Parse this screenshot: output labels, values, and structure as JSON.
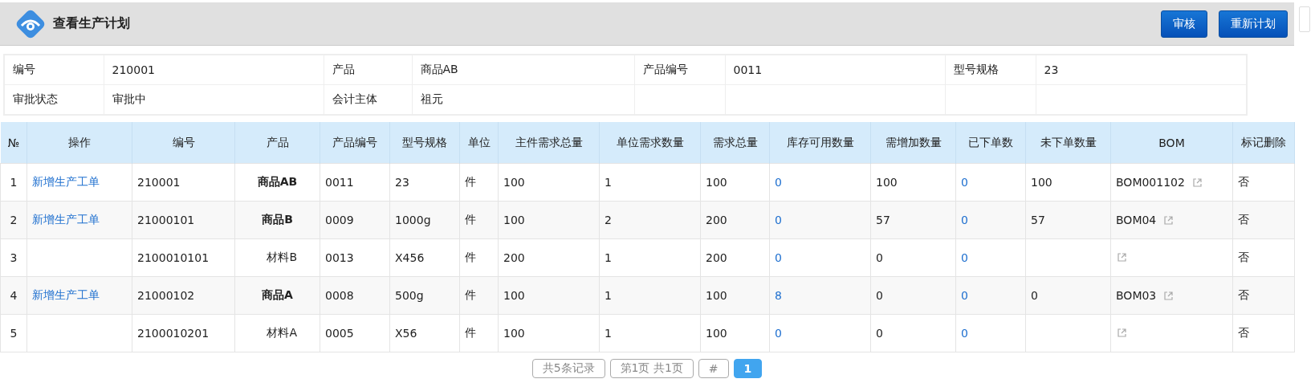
{
  "header": {
    "title": "查看生产计划",
    "buttons": [
      "审核",
      "重新计划"
    ]
  },
  "info": [
    [
      {
        "label": "编号",
        "value": "210001"
      },
      {
        "label": "产品",
        "value": "商品AB"
      },
      {
        "label": "产品编号",
        "value": "0011"
      },
      {
        "label": "型号规格",
        "value": "23"
      }
    ],
    [
      {
        "label": "审批状态",
        "value": "审批中"
      },
      {
        "label": "会计主体",
        "value": "祖元"
      }
    ]
  ],
  "table": {
    "columns": [
      "№",
      "操作",
      "编号",
      "产品",
      "产品编号",
      "型号规格",
      "单位",
      "主件需求总量",
      "单位需求数量",
      "需求总量",
      "库存可用数量",
      "需增加数量",
      "已下单数",
      "未下单数量",
      "BOM",
      "标记删除"
    ],
    "rows": [
      {
        "no": "1",
        "action": "新增生产工单",
        "code": "210001",
        "product": "商品AB",
        "kind": "product",
        "product_code": "0011",
        "spec": "23",
        "unit": "件",
        "main_qty": "100",
        "unit_qty": "1",
        "total_qty": "100",
        "stock": "0",
        "increase": "100",
        "ordered": "0",
        "unordered": "100",
        "bom": "BOM001102",
        "deleted": "否"
      },
      {
        "no": "2",
        "action": "新增生产工单",
        "code": "21000101",
        "product": "商品B",
        "kind": "product",
        "product_code": "0009",
        "spec": "1000g",
        "unit": "件",
        "main_qty": "100",
        "unit_qty": "2",
        "total_qty": "200",
        "stock": "0",
        "increase": "57",
        "ordered": "0",
        "unordered": "57",
        "bom": "BOM04",
        "deleted": "否"
      },
      {
        "no": "3",
        "code": "2100010101",
        "product": "材料B",
        "kind": "material",
        "product_code": "0013",
        "spec": "X456",
        "unit": "件",
        "main_qty": "200",
        "unit_qty": "1",
        "total_qty": "200",
        "stock": "0",
        "increase": "0",
        "ordered": "0",
        "deleted": "否"
      },
      {
        "no": "4",
        "action": "新增生产工单",
        "code": "21000102",
        "product": "商品A",
        "kind": "product",
        "product_code": "0008",
        "spec": "500g",
        "unit": "件",
        "main_qty": "100",
        "unit_qty": "1",
        "total_qty": "100",
        "stock": "8",
        "increase": "0",
        "ordered": "0",
        "unordered": "0",
        "bom": "BOM03",
        "deleted": "否"
      },
      {
        "no": "5",
        "code": "2100010201",
        "product": "材料A",
        "kind": "material",
        "product_code": "0005",
        "spec": "X56",
        "unit": "件",
        "main_qty": "100",
        "unit_qty": "1",
        "total_qty": "100",
        "stock": "0",
        "increase": "0",
        "ordered": "0",
        "deleted": "否"
      }
    ]
  },
  "pagination": [
    {
      "label": "共5条记录",
      "selected": false
    },
    {
      "label": "第1页 共1页",
      "selected": false
    },
    {
      "label": "#",
      "selected": false
    },
    {
      "label": "1",
      "selected": true
    }
  ]
}
